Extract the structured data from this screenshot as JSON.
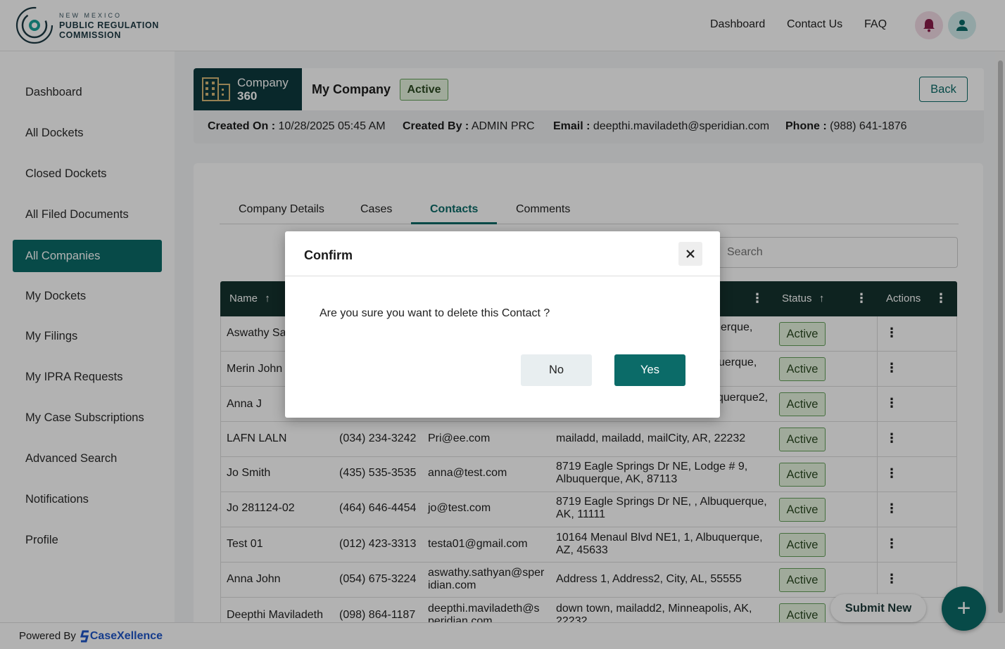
{
  "header": {
    "logo_small": "NEW MEXICO",
    "logo_line1": "PUBLIC REGULATION",
    "logo_line2": "COMMISSION",
    "nav": [
      "Dashboard",
      "Contact Us",
      "FAQ"
    ]
  },
  "sidebar": {
    "items": [
      {
        "label": "Dashboard"
      },
      {
        "label": "All Dockets"
      },
      {
        "label": "Closed Dockets"
      },
      {
        "label": "All Filed Documents"
      },
      {
        "label": "All Companies",
        "active": true
      },
      {
        "label": "My Dockets"
      },
      {
        "label": "My Filings"
      },
      {
        "label": "My IPRA Requests"
      },
      {
        "label": "My Case Subscriptions"
      },
      {
        "label": "Advanced Search"
      },
      {
        "label": "Notifications"
      },
      {
        "label": "Profile"
      }
    ]
  },
  "company": {
    "module_line1": "Company",
    "module_line2": "360",
    "name": "My Company",
    "status": "Active",
    "back_label": "Back",
    "created_on_label": "Created On :",
    "created_on": "10/28/2025 05:45 AM",
    "created_by_label": "Created By :",
    "created_by": "ADMIN PRC",
    "email_label": "Email :",
    "email": "deepthi.maviladeth@speridian.com",
    "phone_label": "Phone :",
    "phone": "(988) 641-1876"
  },
  "tabs": [
    "Company Details",
    "Cases",
    "Contacts",
    "Comments"
  ],
  "active_tab": "Contacts",
  "search": {
    "placeholder": "Search"
  },
  "table": {
    "headers": {
      "name": "Name",
      "status": "Status",
      "actions": "Actions"
    },
    "rows": [
      {
        "name": "Aswathy Sa",
        "phone": "",
        "email": "",
        "address": "erque,",
        "status": "Active"
      },
      {
        "name": "Merin John",
        "phone": "",
        "email": "",
        "address": "uerque,",
        "status": "Active"
      },
      {
        "name": "Anna J",
        "phone": "",
        "email": "",
        "address": "querque2,",
        "status": "Active"
      },
      {
        "name": "LAFN LALN",
        "phone": "(034) 234-3242",
        "email": "Pri@ee.com",
        "address": "mailadd, mailadd, mailCity, AR, 22232",
        "status": "Active"
      },
      {
        "name": "Jo Smith",
        "phone": "(435) 535-3535",
        "email": "anna@test.com",
        "address": "8719 Eagle Springs Dr NE, Lodge # 9,",
        "address2": "Albuquerque, AK, 87113",
        "status": "Active"
      },
      {
        "name": "Jo 281124-02",
        "phone": "(464) 646-4454",
        "email": "jo@test.com",
        "address": "8719 Eagle Springs Dr NE, , Albuquerque,",
        "address2": "AK, 11111",
        "status": "Active"
      },
      {
        "name": "Test 01",
        "phone": "(012) 423-3313",
        "email": "testa01@gmail.com",
        "address": "10164 Menaul Blvd NE1, 1, Albuquerque,",
        "address2": "AZ, 45633",
        "status": "Active"
      },
      {
        "name": "Anna John",
        "phone": "(054) 675-3224",
        "email": "aswathy.sathyan@sper",
        "email2": "idian.com",
        "address": "Address 1, Address2, City, AL, 55555",
        "status": "Active"
      },
      {
        "name": "Deepthi Maviladeth",
        "phone": "(098) 864-1187",
        "email": "deepthi.maviladeth@s",
        "email2": "peridian.com",
        "address": "down town, mailadd2, Minneapolis, AK,",
        "address2": "22232",
        "status": "Active"
      }
    ]
  },
  "footer": {
    "powered_by": "Powered By",
    "brand": "CaseXellence"
  },
  "floating": {
    "submit_new": "Submit New",
    "fab_symbol": "+"
  },
  "modal": {
    "title": "Confirm",
    "message": "Are you sure you want to delete this Contact ?",
    "no_label": "No",
    "yes_label": "Yes"
  },
  "colors": {
    "brand_teal": "#0b6b68",
    "header_dark": "#15332f",
    "active_badge_bg": "#e5f4df",
    "active_badge_border": "#63a05a"
  }
}
